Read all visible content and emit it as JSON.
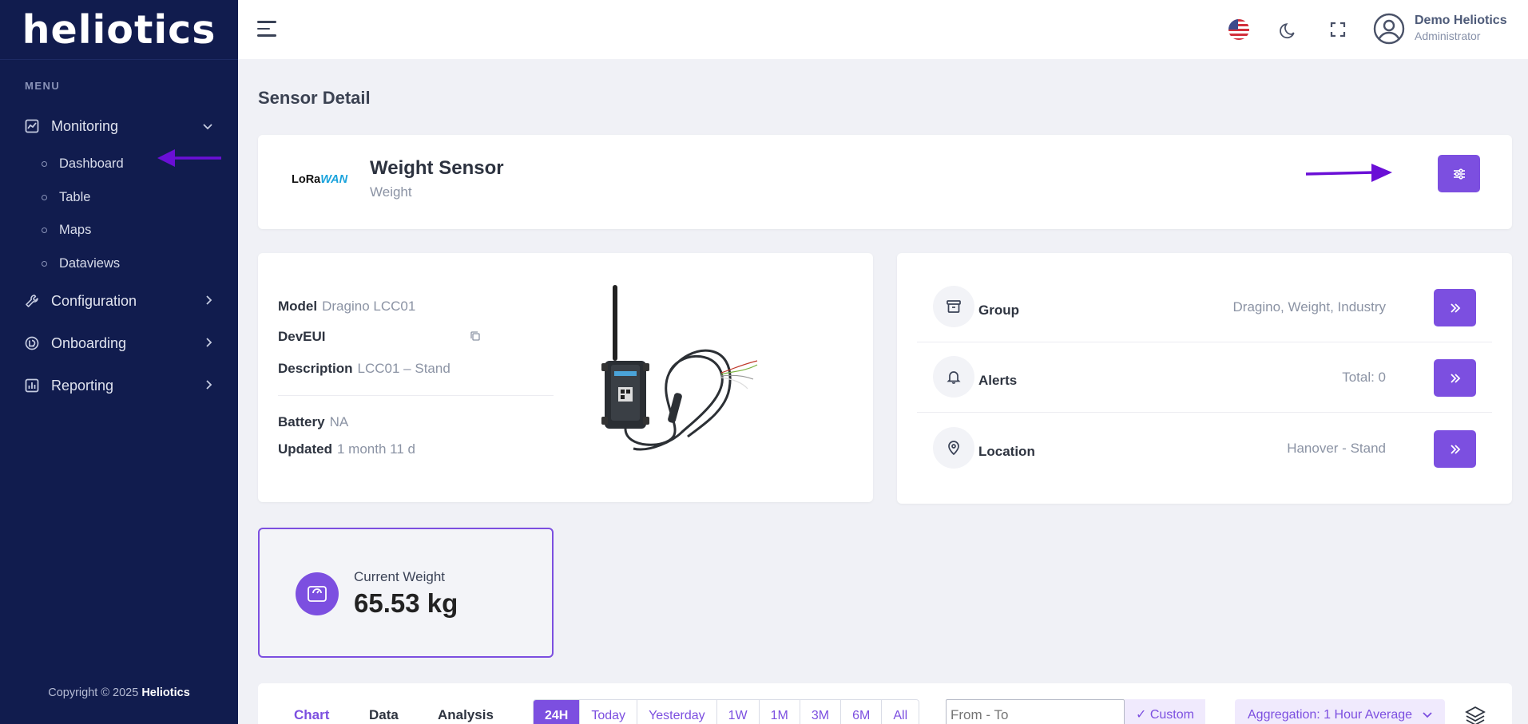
{
  "brand": {
    "logo_text": "heliotics"
  },
  "sidebar": {
    "menu_title": "MENU",
    "items": [
      {
        "label": "Monitoring",
        "icon": "chart-line-icon",
        "expanded": true,
        "children": [
          "Dashboard",
          "Table",
          "Maps",
          "Dataviews"
        ]
      },
      {
        "label": "Configuration",
        "icon": "wrench-icon"
      },
      {
        "label": "Onboarding",
        "icon": "onboarding-icon"
      },
      {
        "label": "Reporting",
        "icon": "bar-chart-icon"
      }
    ],
    "copyright_prefix": "Copyright © 2025",
    "copyright_brand": "Heliotics"
  },
  "topbar": {
    "user_name": "Demo Heliotics",
    "user_role": "Administrator",
    "language_icon": "us-flag-icon"
  },
  "page": {
    "title": "Sensor Detail"
  },
  "sensor": {
    "protocol_logo_a": "LoRa",
    "protocol_logo_b": "WAN",
    "name": "Weight Sensor",
    "type": "Weight"
  },
  "details": {
    "model_label": "Model",
    "model_value": "Dragino LCC01",
    "deveui_label": "DevEUI",
    "deveui_value": "",
    "description_label": "Description",
    "description_value": "LCC01 – Stand",
    "battery_label": "Battery",
    "battery_value": "NA",
    "updated_label": "Updated",
    "updated_value": "1 month 11 d"
  },
  "info": {
    "group_label": "Group",
    "group_value": "Dragino, Weight, Industry",
    "alerts_label": "Alerts",
    "alerts_value": "Total: 0",
    "location_label": "Location",
    "location_value": "Hanover - Stand"
  },
  "current": {
    "label": "Current Weight",
    "value": "65.53 kg"
  },
  "chart_controls": {
    "tabs": [
      "Chart",
      "Data",
      "Analysis"
    ],
    "active_tab": "Chart",
    "ranges": [
      "24H",
      "Today",
      "Yesterday",
      "1W",
      "1M",
      "3M",
      "6M",
      "All"
    ],
    "active_range": "24H",
    "date_placeholder": "From - To",
    "custom_label": "✓ Custom",
    "aggregation_label": "Aggregation: 1 Hour Average"
  },
  "colors": {
    "primary": "#7c4fe0",
    "sidebar": "#111c4e",
    "annotation_arrow": "#6a0fd6"
  }
}
